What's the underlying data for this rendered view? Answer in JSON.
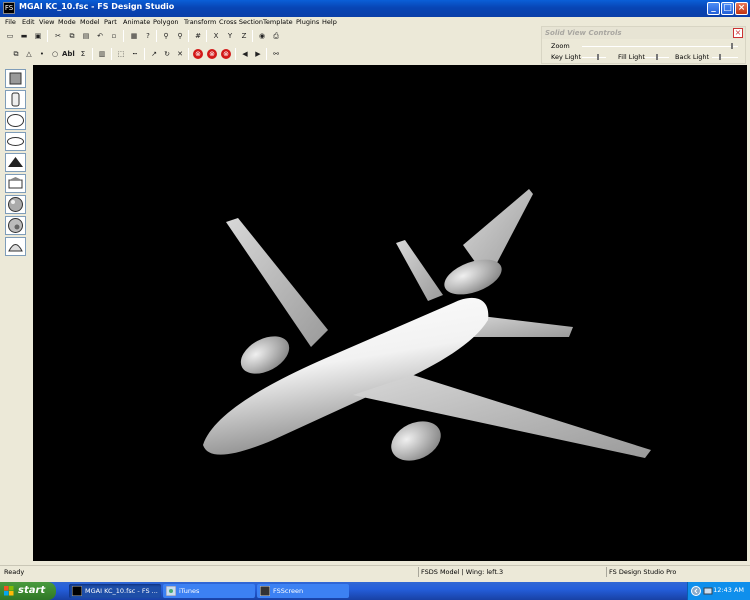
{
  "window": {
    "title": "MGAI KC_10.fsc - FS Design Studio",
    "app_icon_text": "FS"
  },
  "menu": [
    "File",
    "Edit",
    "View",
    "Mode",
    "Model",
    "Part",
    "Animate",
    "Polygon",
    "Transform",
    "Cross Section",
    "Template",
    "Plugins",
    "Help"
  ],
  "solid_view_controls": {
    "title": "Solid View Controls",
    "zoom_label": "Zoom",
    "key_light_label": "Key Light",
    "fill_light_label": "Fill Light",
    "back_light_label": "Back Light",
    "zoom_level": 0.97,
    "key_light_level": 0.7,
    "fill_light_level": 0.5,
    "back_light_level": 0.3
  },
  "statusbar": {
    "left": "Ready",
    "middle": "FSDS Model | Wing: left.3",
    "right": "FS Design Studio Pro"
  },
  "taskbar": {
    "start_label": "start",
    "tasks": [
      "MGAI KC_10.fsc - FS ...",
      "iTunes",
      "FSScreen"
    ],
    "clock": "12:43 AM"
  },
  "colors": {
    "titlebar": "#0a4fc8",
    "viewport_bg": "#000000",
    "taskbar": "#245edb",
    "start_button": "#3c8a30"
  },
  "icons": {
    "toolbar1": [
      "new-file-icon",
      "open-folder-icon",
      "save-icon",
      "cut-icon",
      "copy-icon",
      "paste-icon",
      "undo-icon",
      "blank-icon",
      "properties-icon",
      "help-pointer-icon",
      "zoom-in-icon",
      "zoom-out-icon",
      "grid-icon",
      "mirror-x-icon",
      "mirror-y-icon",
      "mirror-z-icon",
      "eye-icon",
      "print-icon"
    ],
    "toolbar2": [
      "select-part-icon",
      "triangle-icon",
      "point-icon",
      "circle-icon",
      "text-abc-icon",
      "sigma-icon",
      "texture-icon",
      "select-box-icon",
      "dotted-line-icon",
      "bend-arrow-icon",
      "rotate-icon",
      "scale-icon",
      "stop-red-icon",
      "stop-red-icon-2",
      "stop-red-icon-3",
      "arrow-left-icon",
      "arrow-right-icon",
      "binoculars-icon"
    ],
    "palette": [
      "box-icon",
      "cylinder-icon",
      "sphere-icon",
      "disc-icon",
      "cone-icon",
      "wedge-icon",
      "textured-sphere-icon",
      "textured-sphere-2-icon",
      "dome-icon"
    ]
  }
}
